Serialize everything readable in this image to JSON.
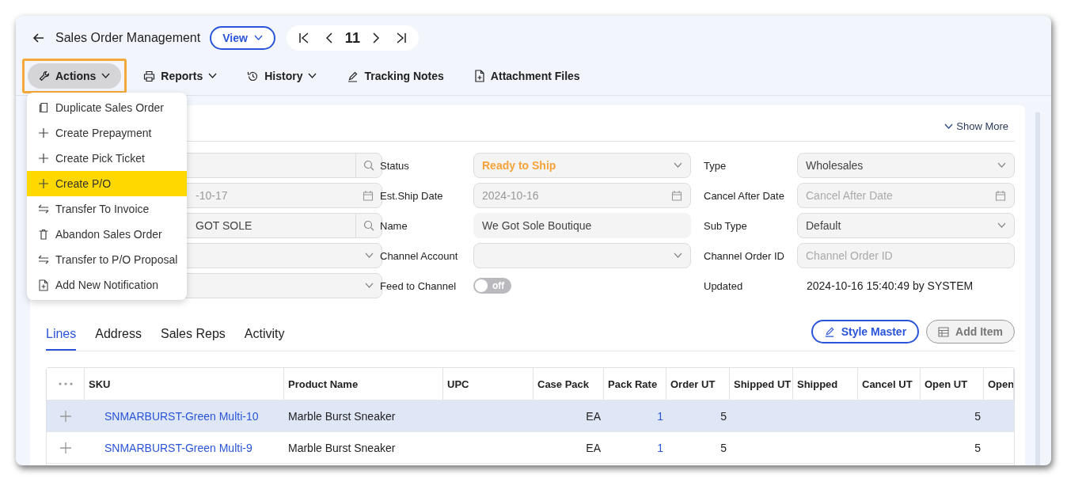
{
  "header": {
    "title": "Sales Order Management",
    "view_button": "View",
    "page_number": "11"
  },
  "toolbar": [
    {
      "label": "Actions",
      "kind": "actions",
      "dropdown": true,
      "expanded": true
    },
    {
      "label": "Reports",
      "kind": "print",
      "dropdown": true,
      "expanded": false
    },
    {
      "label": "History",
      "kind": "history",
      "dropdown": true,
      "expanded": false
    },
    {
      "label": "Tracking Notes",
      "kind": "note",
      "dropdown": false,
      "expanded": false
    },
    {
      "label": "Attachment Files",
      "kind": "file",
      "dropdown": false,
      "expanded": false
    }
  ],
  "actions_menu": [
    {
      "label": "Duplicate Sales Order",
      "kind": "copy",
      "selected": false
    },
    {
      "label": "Create Prepayment",
      "kind": "create",
      "selected": false
    },
    {
      "label": "Create Pick Ticket",
      "kind": "create",
      "selected": false
    },
    {
      "label": "Create P/O",
      "kind": "create",
      "selected": true
    },
    {
      "label": "Transfer To Invoice",
      "kind": "transfer",
      "selected": false
    },
    {
      "label": "Abandon Sales Order",
      "kind": "delete",
      "selected": false
    },
    {
      "label": "Transfer to P/O Proposal",
      "kind": "transfer",
      "selected": false
    },
    {
      "label": "Add New Notification",
      "kind": "notify",
      "selected": false
    }
  ],
  "show_more": "Show More",
  "form": {
    "left_fields": [
      {
        "kind": "search"
      },
      {
        "kind": "date",
        "value": "-10-17",
        "disabled": true
      },
      {
        "kind": "search",
        "value": "GOT SOLE",
        "disabled": false
      },
      {
        "kind": "select"
      },
      {
        "kind": "select"
      }
    ],
    "middle_fields": [
      {
        "label": "Status",
        "kind": "select",
        "value": "Ready to Ship",
        "color": "#f5a33a"
      },
      {
        "label": "Est.Ship Date",
        "kind": "date",
        "value": "2024-10-16",
        "disabled": true
      },
      {
        "label": "Name",
        "kind": "text",
        "value": "We Got Sole Boutique",
        "disabled": false
      },
      {
        "label": "Channel Account",
        "kind": "select"
      },
      {
        "label": "Feed to Channel",
        "kind": "toggle",
        "value": "off",
        "on": false
      }
    ],
    "right_fields": [
      {
        "label": "Type",
        "kind": "select",
        "value": "Wholesales",
        "disabled": false
      },
      {
        "label": "Cancel After Date",
        "kind": "date",
        "placeholder": "Cancel After Date"
      },
      {
        "label": "Sub Type",
        "kind": "select",
        "value": "Default",
        "disabled": false
      },
      {
        "label": "Channel Order ID",
        "kind": "input",
        "placeholder": "Channel Order ID"
      },
      {
        "label": "Updated",
        "kind": "static",
        "value": "2024-10-16 15:40:49 by SYSTEM"
      }
    ]
  },
  "tabs": [
    {
      "label": "Lines",
      "selected": true
    },
    {
      "label": "Address",
      "selected": false
    },
    {
      "label": "Sales Reps",
      "selected": false
    },
    {
      "label": "Activity",
      "selected": false
    }
  ],
  "tab_buttons": [
    {
      "label": "Style Master",
      "kind": "edit",
      "disabled": false
    },
    {
      "label": "Add Item",
      "kind": "table",
      "disabled": true
    }
  ],
  "table": {
    "columns": [
      "SKU",
      "Product Name",
      "UPC",
      "Case Pack",
      "Pack Rate",
      "Order UT",
      "Shipped UT",
      "Shipped",
      "Cancel UT",
      "Open UT",
      "Open"
    ],
    "rows": [
      {
        "sku": "SNMARBURST-Green Multi-10",
        "product_name": "Marble Burst Sneaker",
        "case_pack": "EA",
        "pack_rate": "1",
        "order_ut": "5",
        "open_ut": "5",
        "selected": true
      },
      {
        "sku": "SNMARBURST-Green Multi-9",
        "product_name": "Marble Burst Sneaker",
        "case_pack": "EA",
        "pack_rate": "1",
        "order_ut": "5",
        "open_ut": "5",
        "selected": false
      }
    ]
  }
}
